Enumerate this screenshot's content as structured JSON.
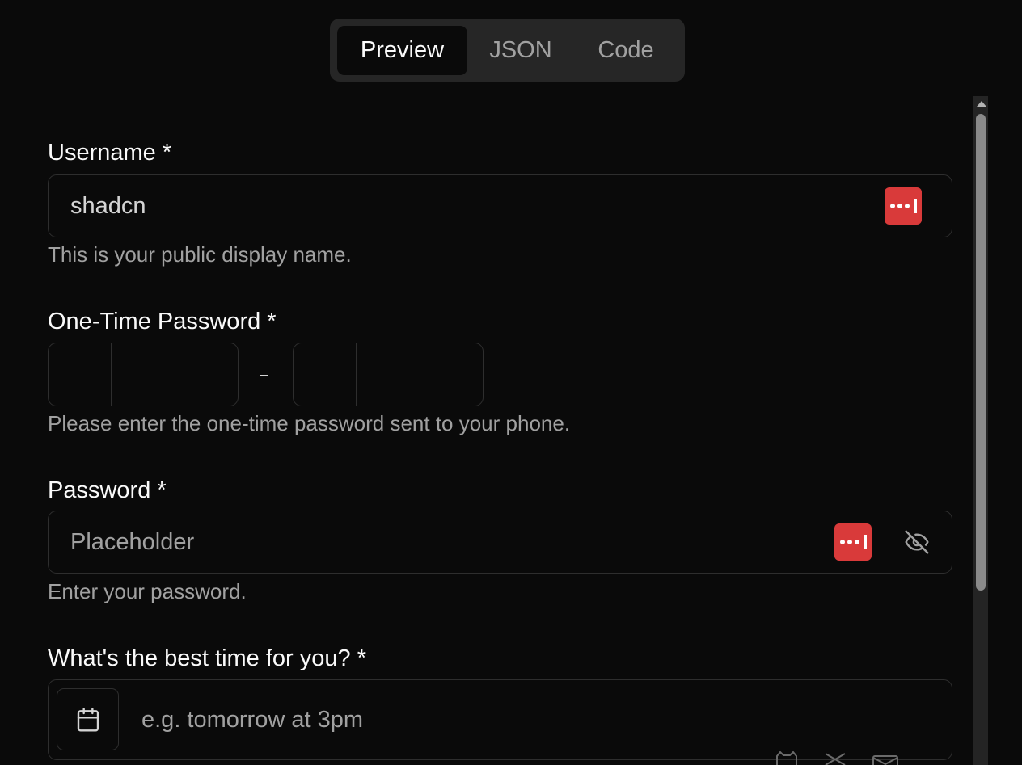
{
  "tabs": [
    {
      "label": "Preview",
      "active": true
    },
    {
      "label": "JSON",
      "active": false
    },
    {
      "label": "Code",
      "active": false
    }
  ],
  "form": {
    "username": {
      "label": "Username *",
      "value": "shadcn",
      "description": "This is your public display name."
    },
    "otp": {
      "label": "One-Time Password *",
      "description": "Please enter the one-time password sent to your phone."
    },
    "password": {
      "label": "Password *",
      "placeholder": "Placeholder",
      "description": "Enter your password."
    },
    "best_time": {
      "label": "What's the best time for you? *",
      "placeholder": "e.g. tomorrow at 3pm"
    }
  },
  "icons": {
    "password_manager": "password-manager-icon",
    "toggle_visibility": "eye-off-icon",
    "calendar": "calendar-icon",
    "footer": [
      "github-icon",
      "x-icon",
      "mail-icon"
    ]
  },
  "colors": {
    "background": "#0a0a0a",
    "password_manager_red": "#d93a3a",
    "border": "#2e2e2e",
    "muted_text": "#a1a1a1"
  }
}
